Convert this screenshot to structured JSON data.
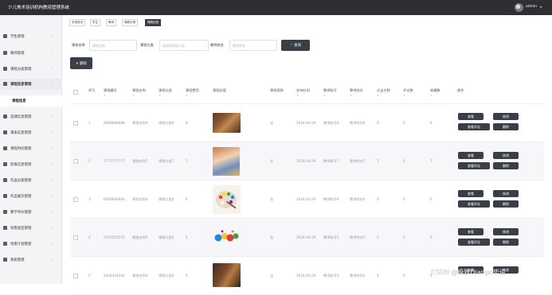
{
  "header": {
    "title": "少儿美术培训机构教培管理系统",
    "username": "admin"
  },
  "sidebar": {
    "items": [
      {
        "label": "学生管理"
      },
      {
        "label": "教师管理"
      },
      {
        "label": "课程分类管理"
      },
      {
        "label": "课程信息管理"
      },
      {
        "label": "选课信息管理"
      },
      {
        "label": "课表信息管理"
      },
      {
        "label": "课程时间管理"
      },
      {
        "label": "剪报信息管理"
      },
      {
        "label": "作品分类管理"
      },
      {
        "label": "作品展示管理"
      },
      {
        "label": "教学评价管理"
      },
      {
        "label": "场景类型管理"
      },
      {
        "label": "场景计划管理"
      },
      {
        "label": "系统管理"
      }
    ],
    "active_sub": "课程信息"
  },
  "tabs": [
    {
      "label": "系统首页"
    },
    {
      "label": "学生"
    },
    {
      "label": "教师"
    },
    {
      "label": "课程分类"
    },
    {
      "label": "课程信息"
    }
  ],
  "search": {
    "label_name": "课程名称",
    "placeholder_name": "课程名称",
    "label_category": "课程分类",
    "placeholder_category": "请选择课程分类",
    "label_teacher": "教师姓名",
    "placeholder_teacher": "教师姓名",
    "button": "♡ 查询"
  },
  "toolbar": {
    "delete_label": "✕ 删除"
  },
  "table": {
    "headers": [
      "序号",
      "课程编号",
      "课程名称",
      "课程分类",
      "课程费用",
      "课程封面",
      "课程视频",
      "发布时间",
      "教师账号",
      "教师姓名",
      "点击次数",
      "评论数",
      "收藏数",
      "操作"
    ],
    "sort_glyph": "⇕",
    "rows": [
      {
        "index": "1",
        "code": "8888888888",
        "name": "课程名称8",
        "category": "课程分类8",
        "fee": "8",
        "video": "无",
        "date": "2024-04-29",
        "account": "教师账号8",
        "teacher": "教师姓名8",
        "clicks": "8",
        "comments": "0",
        "favorites": "8"
      },
      {
        "index": "2",
        "code": "7777777777",
        "name": "课程名称7",
        "category": "课程分类7",
        "fee": "7",
        "video": "无",
        "date": "2024-04-29",
        "account": "教师账号7",
        "teacher": "教师姓名7",
        "clicks": "7",
        "comments": "0",
        "favorites": "7"
      },
      {
        "index": "3",
        "code": "6666666666",
        "name": "课程名称6",
        "category": "课程分类6",
        "fee": "6",
        "video": "无",
        "date": "2024-04-29",
        "account": "教师账号6",
        "teacher": "教师姓名6",
        "clicks": "6",
        "comments": "0",
        "favorites": "6"
      },
      {
        "index": "4",
        "code": "5555555555",
        "name": "课程名称5",
        "category": "课程分类5",
        "fee": "5",
        "video": "无",
        "date": "2024-04-29",
        "account": "教师账号5",
        "teacher": "教师姓名5",
        "clicks": "5",
        "comments": "0",
        "favorites": "5"
      },
      {
        "index": "5",
        "code": "4444444444",
        "name": "课程名称4",
        "category": "课程分类4",
        "fee": "4",
        "video": "无",
        "date": "2024-04-29",
        "account": "教师账号4",
        "teacher": "教师姓名4",
        "clicks": "4",
        "comments": "0",
        "favorites": "4"
      }
    ],
    "actions": {
      "view": "查看",
      "edit": "修改",
      "view_comments": "查看评论",
      "delete": "删除"
    }
  },
  "watermark": "CSDN @极致Django毕设",
  "colors": {
    "topbar": "#2f2f33",
    "button": "#3a3f47",
    "sidebar": "#f4f4f6"
  }
}
